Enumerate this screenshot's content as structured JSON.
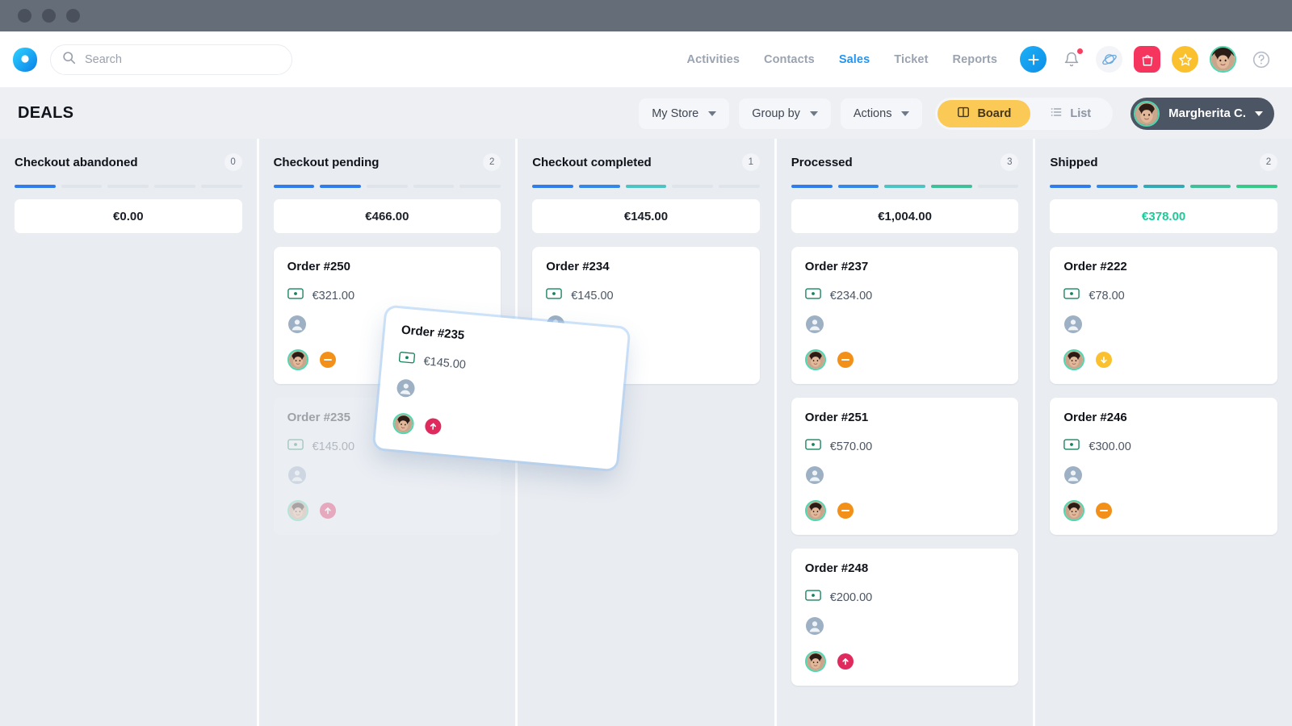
{
  "window": {
    "dots": 3
  },
  "topnav": {
    "brand_icon": "app-logo-icon",
    "search": {
      "placeholder": "Search",
      "value": "",
      "icon": "search-icon"
    },
    "links": [
      {
        "label": "Activities",
        "active": false
      },
      {
        "label": "Contacts",
        "active": false
      },
      {
        "label": "Sales",
        "active": true
      },
      {
        "label": "Ticket",
        "active": false
      },
      {
        "label": "Reports",
        "active": false
      }
    ],
    "icons": [
      {
        "name": "add-plus-icon",
        "glyph": "+"
      },
      {
        "name": "notification-bell-icon",
        "badge": true
      },
      {
        "name": "planet-explore-icon"
      },
      {
        "name": "shopping-bag-icon"
      },
      {
        "name": "favorites-star-icon"
      },
      {
        "name": "profile-avatar-icon"
      },
      {
        "name": "help-question-icon",
        "glyph": "?"
      }
    ],
    "accent_blue": "#2196f3"
  },
  "toolbar": {
    "page_title": "DEALS",
    "store_filter": "My Store",
    "group_by": "Group by",
    "actions": "Actions",
    "view_board": "Board",
    "view_list": "List",
    "active_view": "Board",
    "user_name": "Margherita C.",
    "board_accent": "#fbc956",
    "user_pill_bg": "#4b5563"
  },
  "board": {
    "columns": [
      {
        "title": "Checkout abandoned",
        "count": "0",
        "total": "€0.00",
        "total_color": "#1b1f27",
        "segments": [
          "#2f7ded",
          "#dfe3ea",
          "#dfe3ea",
          "#dfe3ea",
          "#dfe3ea"
        ],
        "cards": []
      },
      {
        "title": "Checkout pending",
        "count": "2",
        "total": "€466.00",
        "total_color": "#1b1f27",
        "segments": [
          "#2f7ded",
          "#2f7ded",
          "#dfe3ea",
          "#dfe3ea",
          "#dfe3ea"
        ],
        "cards": [
          {
            "title": "Order #250",
            "amount": "€321.00",
            "priority": "medium",
            "ghost": false
          },
          {
            "title": "Order #235",
            "amount": "€145.00",
            "priority": "high",
            "ghost": true
          }
        ]
      },
      {
        "title": "Checkout completed",
        "count": "1",
        "total": "€145.00",
        "total_color": "#1b1f27",
        "segments": [
          "#2f7ded",
          "#3287e8",
          "#4ec3c4",
          "#dfe3ea",
          "#dfe3ea"
        ],
        "cards": [
          {
            "title": "Order #234",
            "amount": "€145.00",
            "priority": "none",
            "ghost": false
          }
        ]
      },
      {
        "title": "Processed",
        "count": "3",
        "total": "€1,004.00",
        "total_color": "#1b1f27",
        "segments": [
          "#2f7ded",
          "#3287e8",
          "#4ec3c4",
          "#3fbf9a",
          "#dfe3ea"
        ],
        "cards": [
          {
            "title": "Order #237",
            "amount": "€234.00",
            "priority": "medium",
            "ghost": false
          },
          {
            "title": "Order #251",
            "amount": "€570.00",
            "priority": "medium",
            "ghost": false
          },
          {
            "title": "Order #248",
            "amount": "€200.00",
            "priority": "high",
            "ghost": false
          }
        ]
      },
      {
        "title": "Shipped",
        "count": "2",
        "total": "€378.00",
        "total_color": "#20c997",
        "segments": [
          "#2f7ded",
          "#3287e8",
          "#34a9b5",
          "#3fbf9a",
          "#35c98a"
        ],
        "cards": [
          {
            "title": "Order #222",
            "amount": "€78.00",
            "priority": "low",
            "ghost": false
          },
          {
            "title": "Order #246",
            "amount": "€300.00",
            "priority": "medium",
            "ghost": false
          }
        ]
      }
    ]
  },
  "drag_card": {
    "title": "Order #235",
    "amount": "€145.00",
    "priority": "high"
  },
  "icons": {
    "money": "banknote-icon",
    "person": "person-placeholder-icon",
    "avatar": "assignee-avatar-icon",
    "priority": "priority-badge-icon"
  }
}
